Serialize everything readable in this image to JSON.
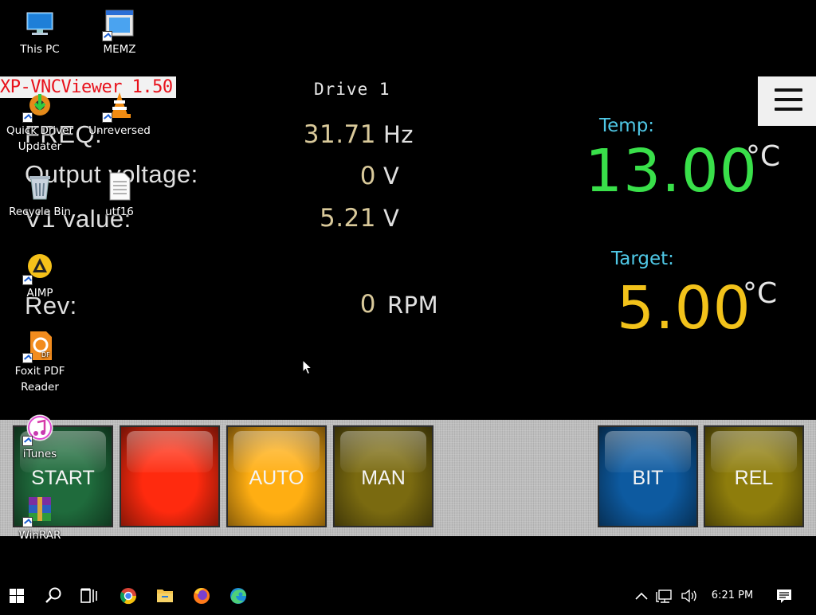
{
  "hmi": {
    "window_title": "XP-VNCViewer 1.50",
    "drive_title": "Drive 1",
    "params": [
      {
        "label": "FREQ:",
        "value": "31.71",
        "unit": "Hz"
      },
      {
        "label": "Output voltage:",
        "value": "0",
        "unit": "V"
      },
      {
        "label": "V1 value:",
        "value": "5.21",
        "unit": "V"
      },
      {
        "label": "Rev:",
        "value": "0",
        "unit": "RPM"
      }
    ],
    "temp": {
      "label": "Temp:",
      "value": "13.00",
      "unit": "°C",
      "color": "#39e04a"
    },
    "target": {
      "label": "Target:",
      "value": "5.00",
      "unit": "°C",
      "color": "#f2c21a"
    },
    "menu_icon": "hamburger-icon",
    "buttons": [
      {
        "label": "START",
        "color": "#1f6b3c"
      },
      {
        "label": "",
        "color": "#ff2a0e"
      },
      {
        "label": "AUTO",
        "color": "#ffae12"
      },
      {
        "label": "MAN",
        "color": "#7a6a10"
      },
      {
        "label": "BIT",
        "color": "#0d5aa0"
      },
      {
        "label": "REL",
        "color": "#8e7d0c"
      }
    ]
  },
  "desktop": {
    "icons": [
      {
        "label": "This PC",
        "icon": "computer-icon"
      },
      {
        "label": "MEMZ",
        "icon": "app-window-icon"
      },
      {
        "label": "Quick Driver Updater",
        "icon": "gear-download-icon"
      },
      {
        "label": "Unreversed",
        "icon": "vlc-cone-icon"
      },
      {
        "label": "Recycle Bin",
        "icon": "recycle-bin-icon"
      },
      {
        "label": "utf16",
        "icon": "text-file-icon"
      },
      {
        "label": "AIMP",
        "icon": "aimp-icon"
      },
      {
        "label": "Foxit PDF Reader",
        "icon": "foxit-pdf-icon"
      },
      {
        "label": "iTunes",
        "icon": "itunes-icon"
      },
      {
        "label": "WinRAR",
        "icon": "winrar-icon"
      }
    ]
  },
  "taskbar": {
    "apps": [
      "windows-start-icon",
      "search-icon",
      "task-view-icon",
      "chrome-icon",
      "file-explorer-icon",
      "firefox-icon",
      "edge-icon"
    ],
    "tray": [
      "chevron-up-icon",
      "network-icon",
      "volume-icon"
    ],
    "clock": "6:21 PM",
    "notifications_icon": "action-center-icon"
  }
}
